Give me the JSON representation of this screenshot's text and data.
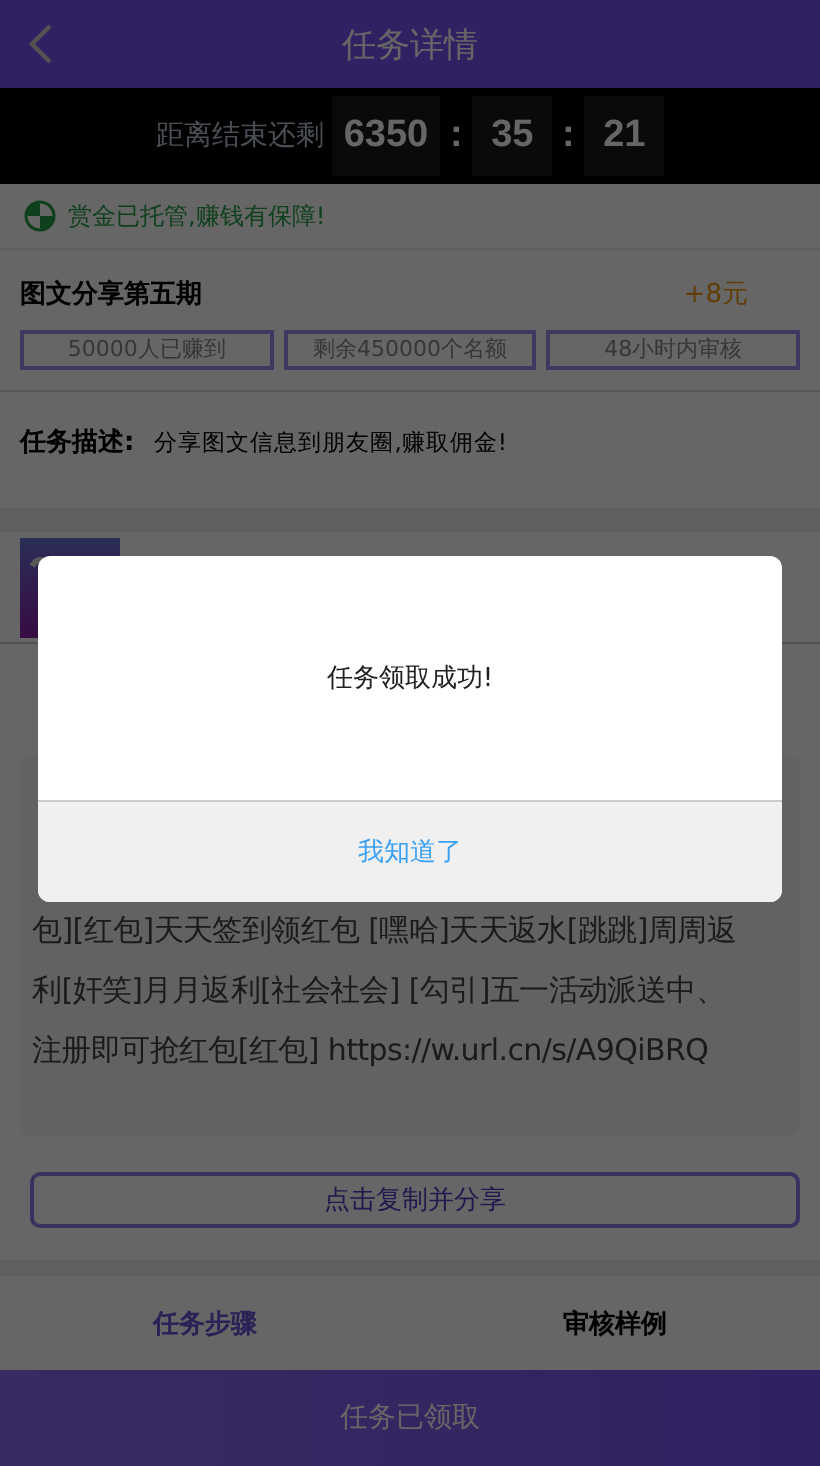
{
  "header": {
    "title": "任务详情"
  },
  "countdown": {
    "label": "距离结束还剩",
    "segments": [
      {
        "kind": "box",
        "text": "6350"
      },
      {
        "kind": "sep",
        "text": ":"
      },
      {
        "kind": "box",
        "text": "35"
      },
      {
        "kind": "sep",
        "text": ":"
      },
      {
        "kind": "box",
        "text": "21"
      }
    ]
  },
  "guarantee": "赏金已托管,赚钱有保障!",
  "task": {
    "title": "图文分享第五期",
    "reward": "+8元",
    "tags": [
      "50000人已赚到",
      "剩余450000个名额",
      "48小时内审核"
    ]
  },
  "description": {
    "label": "任务描述:",
    "text": "分享图文信息到朋友圈,赚取佣金!"
  },
  "share_text": [
    "包][红包]天天签到领红包 [嘿哈]天天返水[跳跳]周周返",
    "利[奸笑]月月返利[社会社会] [勾引]五一活动派送中、",
    "注册即可抢红包[红包] https://w.url.cn/s/A9QiBRQ"
  ],
  "copy_button": "点击复制并分享",
  "tabs": [
    {
      "label": "任务步骤",
      "selected": true
    },
    {
      "label": "审核样例",
      "selected": false
    }
  ],
  "bottom_button": "任务已领取",
  "dialog": {
    "message": "任务领取成功!",
    "button": "我知道了"
  }
}
